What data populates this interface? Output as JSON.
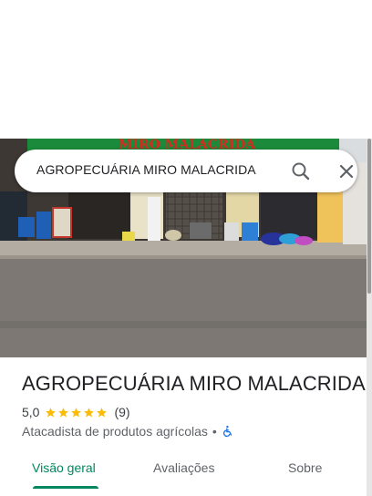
{
  "search": {
    "query": "AGROPECUÁRIA MIRO MALACRIDA"
  },
  "hero": {
    "storefront_sign": "MIRO MALACRIDA"
  },
  "place": {
    "name": "AGROPECUÁRIA MIRO MALACRIDA",
    "rating": "5,0",
    "stars": 5,
    "review_count": "(9)",
    "category": "Atacadista de produtos agrícolas",
    "separator": "•",
    "accessibility_icon": "wheelchair-icon"
  },
  "tabs": [
    {
      "label": "Visão geral",
      "active": true
    },
    {
      "label": "Avaliações",
      "active": false
    },
    {
      "label": "Sobre",
      "active": false
    }
  ],
  "colors": {
    "accent": "#01875f",
    "star": "#fbbc04",
    "accessibility": "#1a73e8"
  }
}
